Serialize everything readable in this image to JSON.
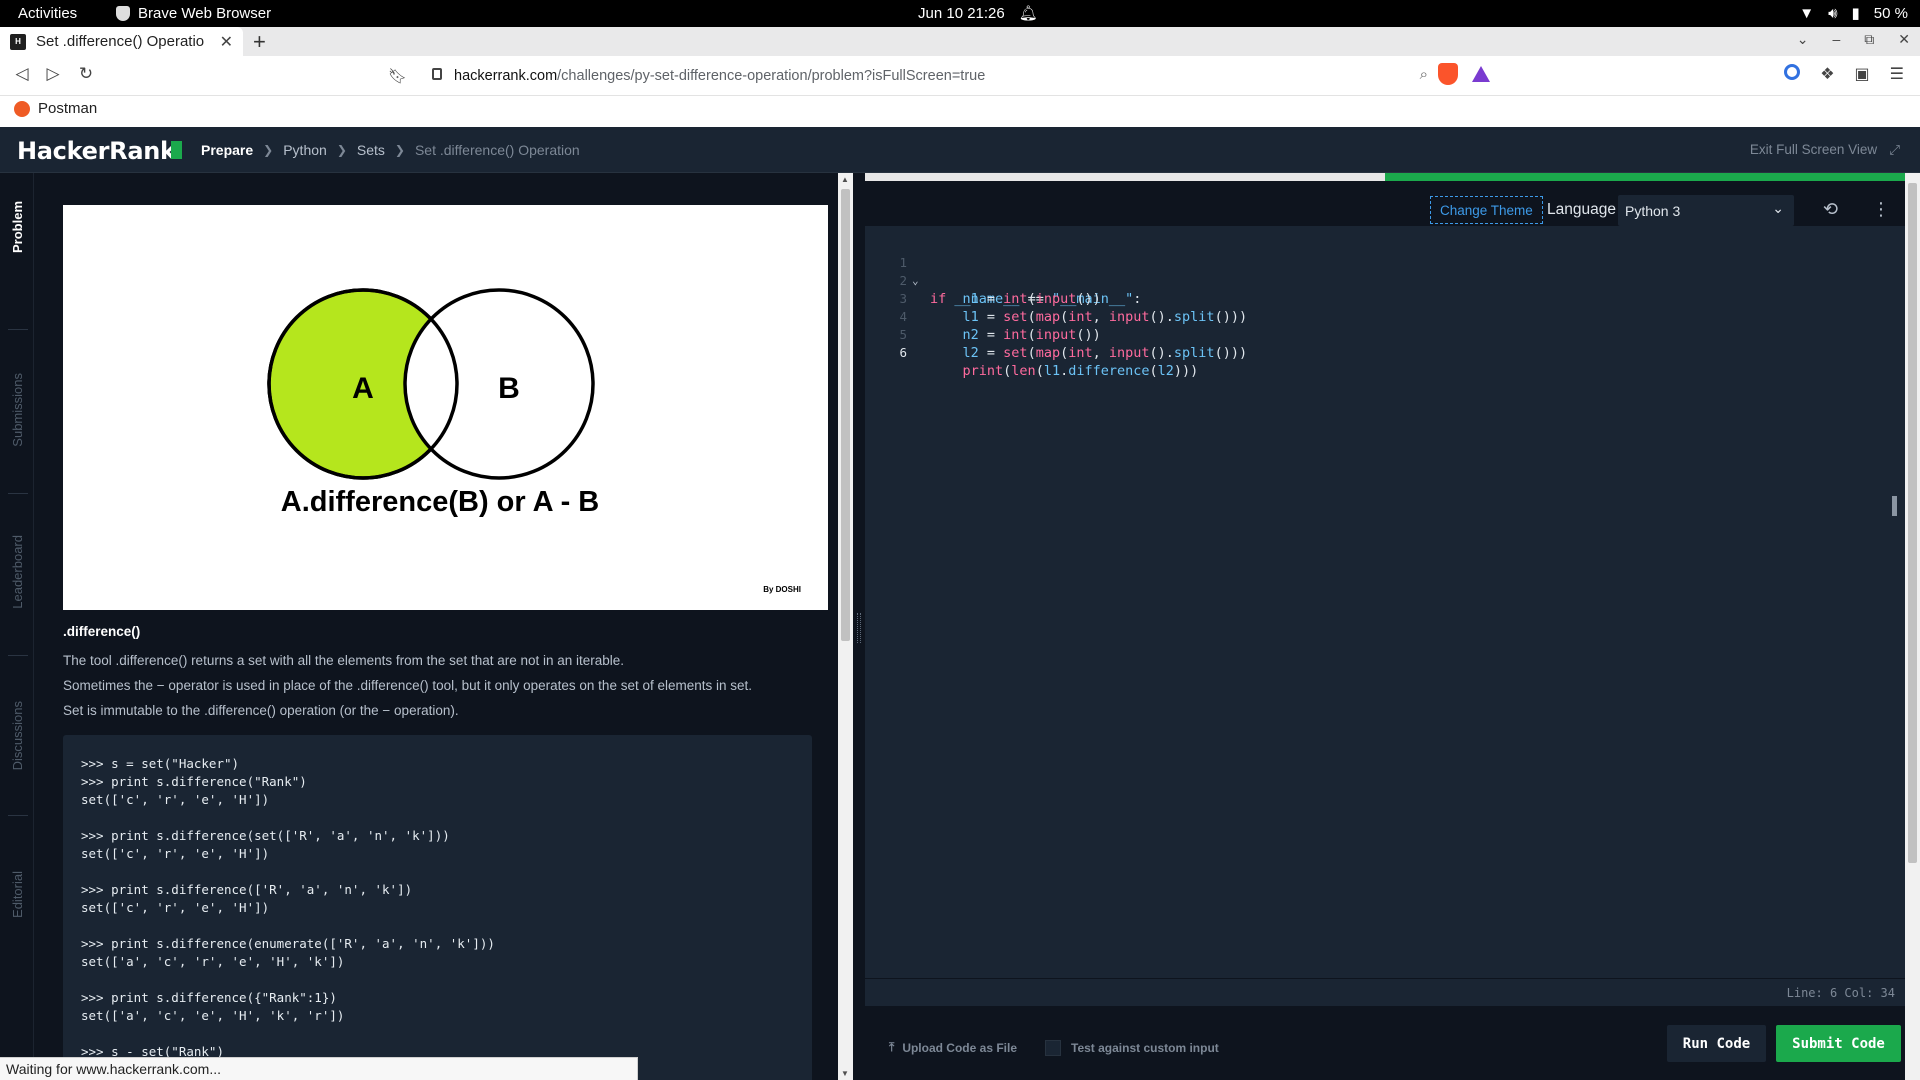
{
  "system_bar": {
    "activities": "Activities",
    "app_name": "Brave Web Browser",
    "datetime": "Jun 10  21:26",
    "battery": "50 %"
  },
  "browser": {
    "tab_title": "Set .difference() Operatio",
    "url_host": "hackerrank.com",
    "url_path": "/challenges/py-set-difference-operation/problem?isFullScreen=true",
    "bookmark": "Postman",
    "loading_status": "Waiting for www.hackerrank.com..."
  },
  "header": {
    "logo": "HackerRank",
    "breadcrumbs": {
      "prepare": "Prepare",
      "python": "Python",
      "sets": "Sets",
      "current": "Set .difference() Operation"
    },
    "exit_full_screen": "Exit Full Screen View"
  },
  "side_tabs": {
    "problem": "Problem",
    "submissions": "Submissions",
    "leaderboard": "Leaderboard",
    "discussions": "Discussions",
    "editorial": "Editorial"
  },
  "problem": {
    "venn": {
      "label_a": "A",
      "label_b": "B",
      "caption": "A.difference(B) or A - B",
      "credit": "By DOSHI",
      "highlight_color": "#b5e61d"
    },
    "heading": ".difference()",
    "paragraphs": [
      "The tool .difference() returns a set with all the elements from the set that are not in an iterable.",
      "Sometimes the − operator is used in place of the .difference() tool, but it only operates on the set of elements in set.",
      "Set is immutable to the .difference() operation (or the − operation)."
    ],
    "example_code": ">>> s = set(\"Hacker\")\n>>> print s.difference(\"Rank\")\nset(['c', 'r', 'e', 'H'])\n\n>>> print s.difference(set(['R', 'a', 'n', 'k']))\nset(['c', 'r', 'e', 'H'])\n\n>>> print s.difference(['R', 'a', 'n', 'k'])\nset(['c', 'r', 'e', 'H'])\n\n>>> print s.difference(enumerate(['R', 'a', 'n', 'k']))\nset(['a', 'c', 'r', 'e', 'H', 'k'])\n\n>>> print s.difference({\"Rank\":1})\nset(['a', 'c', 'e', 'H', 'k', 'r'])\n\n>>> s - set(\"Rank\")"
  },
  "editor": {
    "change_theme": "Change Theme",
    "language_label": "Language",
    "language_value": "Python 3",
    "line_numbers": [
      "1",
      "2",
      "3",
      "4",
      "5",
      "6"
    ],
    "cursor_status": "Line: 6 Col: 34",
    "upload_label": "Upload Code as File",
    "custom_input_label": "Test against custom input",
    "run_label": "Run Code",
    "submit_label": "Submit Code",
    "progress_fraction": 0.5
  }
}
